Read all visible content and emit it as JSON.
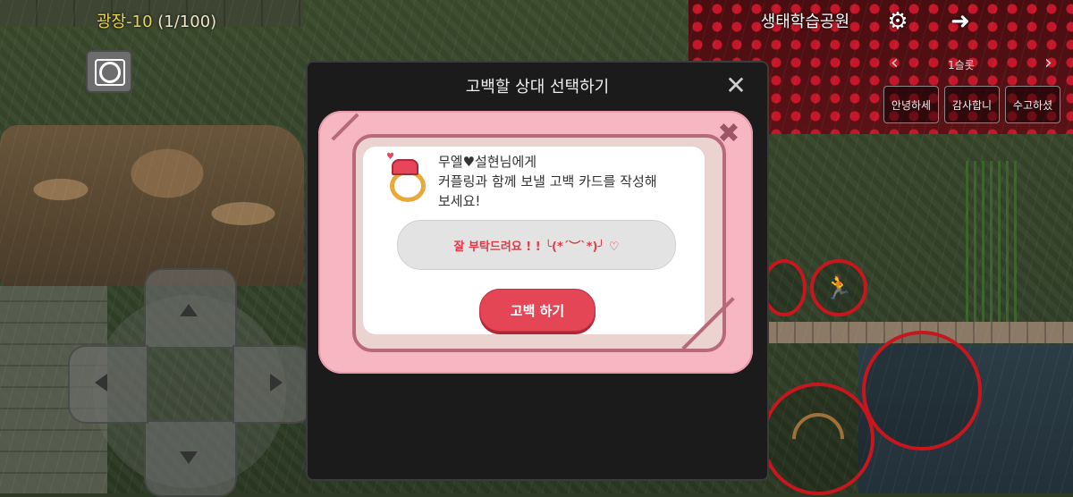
{
  "hud": {
    "location": "광장-10",
    "occupancy": "(1/100)",
    "map_name": "생태학습공원",
    "settings_icon": "gear-icon",
    "back_icon": "back-arrow-icon",
    "camera_icon": "camera-icon"
  },
  "emote_bar": {
    "slot_label": "1슬롯",
    "buttons": [
      "안녕하세",
      "감사합니",
      "수고하셨"
    ]
  },
  "modal": {
    "title": "고백할 상대 선택하기",
    "close_symbol": "✕"
  },
  "card": {
    "close_symbol": "✖",
    "message_lines": [
      "무엘♥설현님에게",
      "커플링과 함께 보낼 고백 카드를 작성해",
      "보세요!"
    ],
    "input_value": "잘 부탁드려요 ! !  ╰(*´︶`*)╯  ♡",
    "confess_button": "고백 하기",
    "icon": "couple-ring-icon"
  },
  "colors": {
    "accent": "#e44656",
    "card_pink": "#f6b6c2",
    "location_yellow": "#e6d35a",
    "action_ring": "#c8161e"
  }
}
